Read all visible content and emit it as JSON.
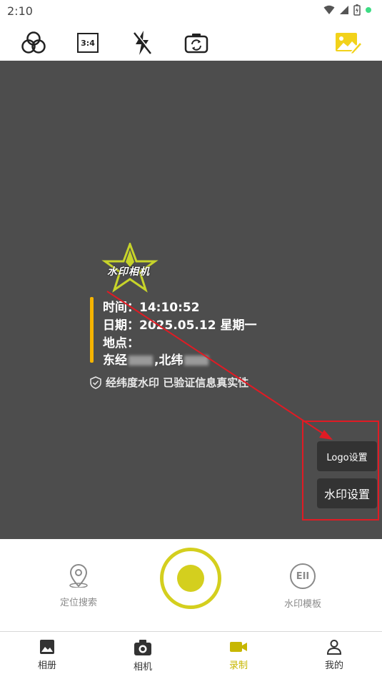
{
  "status_bar": {
    "time": "2:10",
    "icons": [
      "wifi-icon",
      "signal-icon",
      "battery-icon",
      "notification-dot-icon"
    ]
  },
  "toolbar": {
    "icons": [
      "filter-icon",
      "aspect-ratio-icon",
      "flash-off-icon",
      "switch-camera-icon",
      "edit-image-icon"
    ],
    "ratio_label": "3:4"
  },
  "watermark": {
    "logo_text": "水印相机",
    "time_line": "时间：14:10:52",
    "date_line": "日期：2025.05.12 星期一",
    "location_line": "地点：",
    "coord_prefix": "东经",
    "coord_mid": ",北纬",
    "verify_text": "经纬度水印 已验证信息真实性"
  },
  "side_panel": {
    "logo_settings": "Logo设置",
    "watermark_settings": "水印设置"
  },
  "capture": {
    "left_label": "定位搜索",
    "right_label": "水印模板",
    "right_icon_text": "EII"
  },
  "nav": {
    "items": [
      {
        "label": "相册",
        "icon": "album-icon"
      },
      {
        "label": "相机",
        "icon": "camera-icon"
      },
      {
        "label": "录制",
        "icon": "video-icon"
      },
      {
        "label": "我的",
        "icon": "profile-icon"
      }
    ],
    "active_index": 2
  },
  "colors": {
    "preview_bg": "#4d4d4d",
    "accent_yellow": "#d4cf1e",
    "nav_active": "#c7b700",
    "annotation_red": "#e01b24",
    "watermark_bar": "#f5b400"
  }
}
